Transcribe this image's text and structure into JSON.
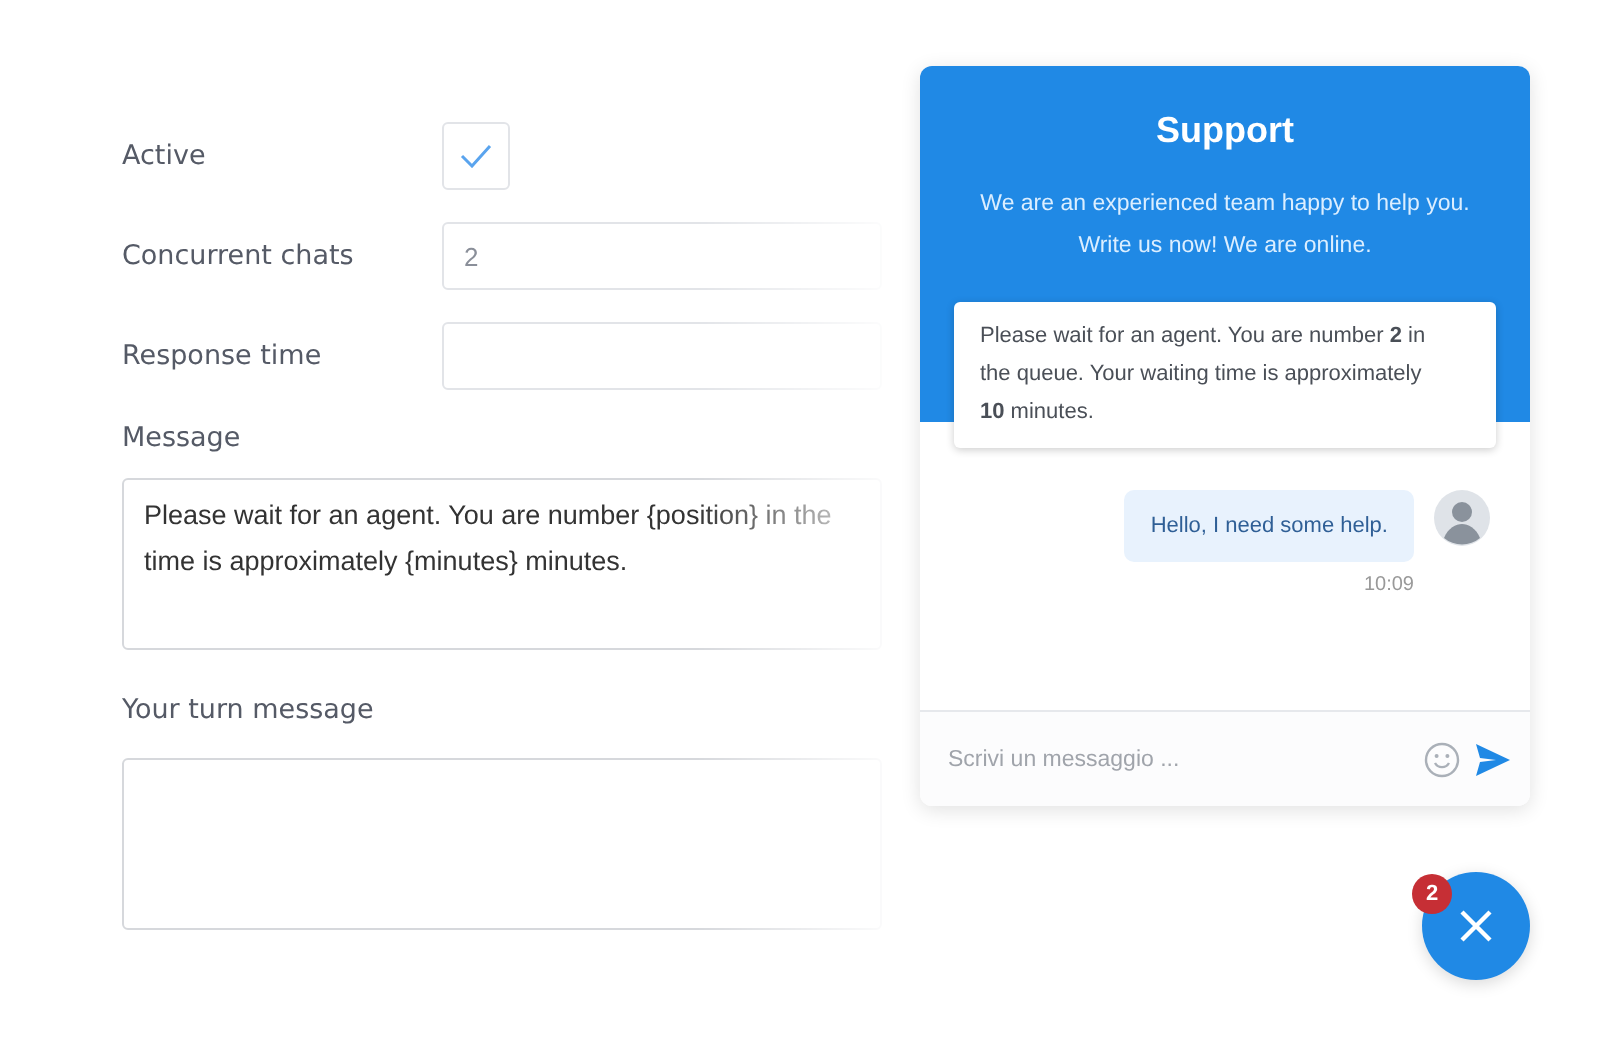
{
  "settings_form": {
    "fields": [
      {
        "kind": "checkbox",
        "label": "Active",
        "checked": true
      },
      {
        "kind": "input",
        "label": "Concurrent chats",
        "value": "2"
      },
      {
        "kind": "input",
        "label": "Response time"
      },
      {
        "kind": "textarea",
        "label": "Message",
        "lines": [
          "Please wait for an agent. You are number {position} in the",
          "time is approximately {minutes} minutes."
        ]
      },
      {
        "kind": "textarea",
        "label": "Your turn message"
      }
    ]
  },
  "chat_widget": {
    "title": "Support",
    "subtitle_lines": [
      "We are an experienced team happy to help you.",
      "Write us now! We are online."
    ],
    "queue_notice": "Please wait for an agent. You are number **2** in the queue. Your waiting time is approximately **10** minutes.",
    "messages": [
      {
        "text": "Hello, I need some help.",
        "time": "10:09"
      }
    ],
    "composer": {
      "placeholder": "Scrivi un messaggio ..."
    }
  },
  "launcher": {
    "badge": "2"
  }
}
